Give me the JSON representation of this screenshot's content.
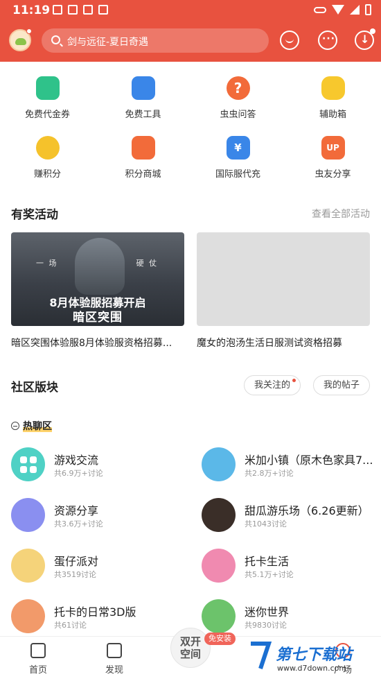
{
  "status_bar": {
    "time": "11:19"
  },
  "search": {
    "placeholder": "剑与远征-夏日奇遇"
  },
  "quick_links": [
    {
      "label": "免费代金券",
      "icon": "coupon-icon",
      "color": "#2fc28a"
    },
    {
      "label": "免费工具",
      "icon": "tool-icon",
      "color": "#3a86e8"
    },
    {
      "label": "虫虫问答",
      "icon": "question-icon",
      "color": "#f26b3a"
    },
    {
      "label": "辅助箱",
      "icon": "robot-icon",
      "color": "#f7c82d"
    },
    {
      "label": "赚积分",
      "icon": "coin-icon",
      "color": "#f5c22b"
    },
    {
      "label": "积分商城",
      "icon": "shop-icon",
      "color": "#f26b3a"
    },
    {
      "label": "国际服代充",
      "icon": "recharge-icon",
      "color": "#3a86e8"
    },
    {
      "label": "虫友分享",
      "icon": "up-icon",
      "color": "#f26b3a"
    }
  ],
  "activities": {
    "title": "有奖活动",
    "view_all": "查看全部活动",
    "items": [
      {
        "caption": "暗区突围体验服8月体验服资格招募...",
        "banner_left": "一 场",
        "banner_right": "硬 仗",
        "banner_promo": "8月体验服招募开启",
        "banner_logo": "暗区突围"
      },
      {
        "caption": "魔女的泡汤生活日服测试资格招募"
      }
    ]
  },
  "community": {
    "title": "社区版块",
    "pills": [
      "我关注的",
      "我的帖子"
    ],
    "hot_label": "热聊区",
    "forums": [
      {
        "name": "游戏交流",
        "sub": "共6.9万+讨论",
        "color": "#4fd1c5"
      },
      {
        "name": "米加小镇（原木色家具7...",
        "sub": "共2.8万+讨论",
        "color": "#5bb8e8"
      },
      {
        "name": "资源分享",
        "sub": "共3.6万+讨论",
        "color": "#8a8ff0"
      },
      {
        "name": "甜瓜游乐场（6.26更新）",
        "sub": "共1043讨论",
        "color": "#3a2e28"
      },
      {
        "name": "蛋仔派对",
        "sub": "共3519讨论",
        "color": "#f5d37a"
      },
      {
        "name": "托卡生活",
        "sub": "共5.1万+讨论",
        "color": "#f08ab0"
      },
      {
        "name": "托卡的日常3D版",
        "sub": "共61讨论",
        "color": "#f29a6a"
      },
      {
        "name": "迷你世界",
        "sub": "共9830讨论",
        "color": "#6cc36b"
      }
    ]
  },
  "bottom_nav": {
    "home": "首页",
    "discover": "发现",
    "center_line1": "双开",
    "center_line2": "空间",
    "center_badge": "免安装",
    "square": "广场"
  },
  "watermark": {
    "brand": "第七下载站",
    "url": "www.d7down.com"
  }
}
